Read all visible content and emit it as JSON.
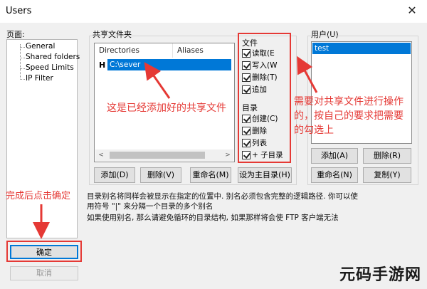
{
  "window": {
    "title": "Users",
    "close_glyph": "✕"
  },
  "pages": {
    "label": "页面:",
    "items": [
      "General",
      "Shared folders",
      "Speed Limits",
      "IP Filter"
    ]
  },
  "shared": {
    "group_label": "共享文件夹",
    "columns": [
      "Directories",
      "Aliases"
    ],
    "row_marker": "H",
    "row_dir": "C:\\sever",
    "buttons": {
      "add": "添加(D)",
      "remove": "删除(V)",
      "rename": "重命名(M)",
      "set_home": "设为主目录(H)"
    }
  },
  "files": {
    "header": "文件",
    "items": [
      "读取(E",
      "写入(W",
      "删除(T)",
      "追加"
    ]
  },
  "dirs": {
    "header": "目录",
    "items": [
      "创建(C)",
      "删除",
      "列表",
      "+ 子目录"
    ]
  },
  "users": {
    "label": "用户(U)",
    "selected": "test",
    "buttons": {
      "add": "添加(A)",
      "remove": "删除(R)",
      "rename": "重命名(N)",
      "copy": "复制(Y)"
    }
  },
  "info": {
    "line1": "目录别名将同样会被显示在指定的位置中. 别名必须包含完整的逻辑路径. 你可以使",
    "line2": "用符号 \"|\" 来分隔一个目录的多个别名",
    "line3": "如果使用别名, 那么请避免循环的目录结构, 如果那样将会使 FTP 客户端无法"
  },
  "dialog": {
    "ok": "确定",
    "cancel": "取消"
  },
  "annotations": {
    "added": "这是已经添加好的共享文件",
    "perm_line1": "需要对共享文件进行操作",
    "perm_line2": "的，按自己的要求把需要",
    "perm_line3": "的勾选上",
    "finish": "完成后点击确定"
  },
  "scroll": {
    "left": "<",
    "right": ">"
  },
  "watermark": {
    "text": "元码手游网"
  },
  "colors": {
    "accent": "#0078d7",
    "annotation": "#e53935"
  }
}
